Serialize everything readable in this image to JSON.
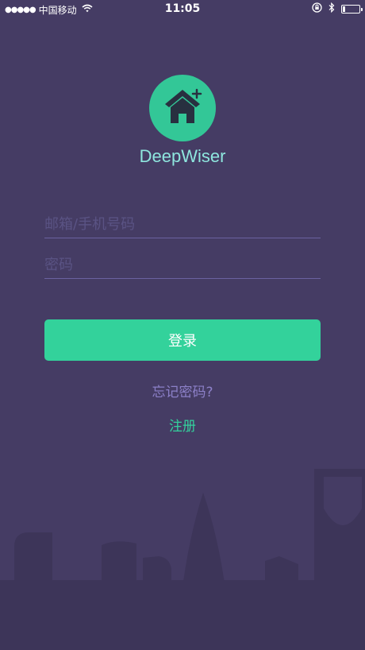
{
  "status_bar": {
    "signal_dots": "●●●●●",
    "carrier": "中国移动",
    "time": "11:05",
    "battery_level": 0.15
  },
  "app": {
    "name": "DeepWiser",
    "logo_icon": "house-plus-icon"
  },
  "form": {
    "email_placeholder": "邮箱/手机号码",
    "email_value": "",
    "password_placeholder": "密码",
    "password_value": ""
  },
  "actions": {
    "login_label": "登录",
    "forgot_label": "忘记密码?",
    "register_label": "注册"
  },
  "colors": {
    "background": "#453c64",
    "accent": "#33d29b",
    "app_name": "#8ee6de",
    "forgot_link": "#8c80c8",
    "skyline": "#3d3559"
  }
}
